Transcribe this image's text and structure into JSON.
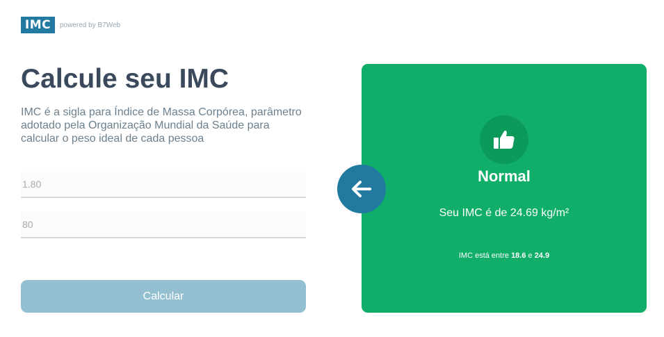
{
  "header": {
    "logo_text": "IMC",
    "powered_by": "powered by B7Web"
  },
  "main": {
    "title": "Calcule seu IMC",
    "description": "IMC é a sigla para Índice de Massa Corpórea, parâmetro adotado pela Organização Mundial da Saúde para calcular o peso ideal de cada pessoa",
    "height_placeholder": "1.80",
    "weight_placeholder": "80",
    "calc_button": "Calcular"
  },
  "result": {
    "icon": "thumbs-up-icon",
    "status": "Normal",
    "imc_text": "Seu IMC é de 24.69 kg/m²",
    "range_prefix": "IMC está entre ",
    "range_min": "18.6",
    "range_sep": " e ",
    "range_max": "24.9",
    "card_color": "#10ae69",
    "back_icon": "arrow-left-icon"
  }
}
